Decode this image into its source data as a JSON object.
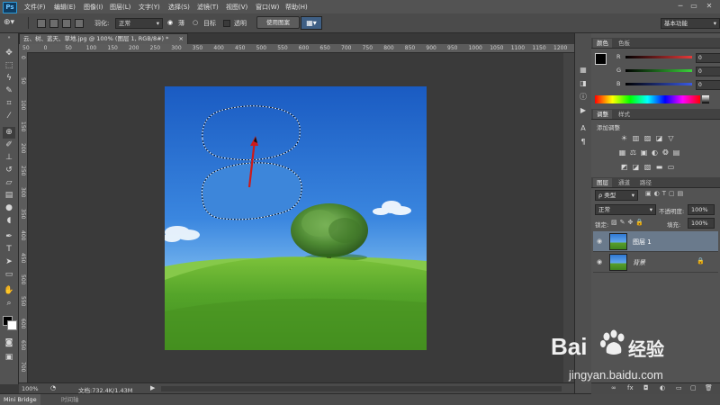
{
  "app": {
    "logo": "Ps"
  },
  "menu": [
    "文件(F)",
    "编辑(E)",
    "图像(I)",
    "图层(L)",
    "文字(Y)",
    "选择(S)",
    "滤镜(T)",
    "视图(V)",
    "窗口(W)",
    "帮助(H)"
  ],
  "window_controls": {
    "minimize": "─",
    "restore": "▭",
    "close": "✕"
  },
  "options": {
    "feather_label": "羽化:",
    "feather_value": "正常",
    "radio_normal": "薄",
    "radio_target": "目标",
    "checkbox_transparent": "透明",
    "use_pattern_button": "使用图案",
    "workspace": "基本功能"
  },
  "document": {
    "tab_title": "云、树、蓝天、草地.jpg @ 100% (图层 1, RGB/8#) *",
    "ruler_top": [
      "50",
      "0",
      "50",
      "100",
      "150",
      "200",
      "250",
      "300",
      "350",
      "400",
      "450",
      "500",
      "550",
      "600",
      "650",
      "700",
      "750",
      "800",
      "850",
      "900",
      "950",
      "1000",
      "1050",
      "1100",
      "1150",
      "1200"
    ],
    "ruler_left": [
      "0",
      "50",
      "100",
      "150",
      "200",
      "250",
      "300",
      "350",
      "400",
      "450",
      "500",
      "550",
      "600",
      "650",
      "700"
    ],
    "zoom": "100%",
    "doc_size": "文档:732.4K/1.43M"
  },
  "bottom_tabs": [
    "Mini Bridge",
    "时间轴"
  ],
  "color_panel": {
    "tabs": [
      "颜色",
      "色板"
    ],
    "channels": [
      {
        "label": "R",
        "value": "0",
        "color": "#e53a3a"
      },
      {
        "label": "G",
        "value": "0",
        "color": "#3ad13a"
      },
      {
        "label": "B",
        "value": "0",
        "color": "#3a5ae5"
      }
    ]
  },
  "adjust_panel": {
    "tabs": [
      "调整",
      "样式"
    ],
    "title": "添加调整",
    "row1": [
      "☀",
      "▥",
      "▨",
      "◪",
      "▽"
    ],
    "row2": [
      "▦",
      "⚖",
      "▣",
      "◐",
      "❂",
      "▤"
    ],
    "row3": [
      "◩",
      "◪",
      "▧",
      "▬",
      "▭"
    ]
  },
  "layers_panel": {
    "tabs": [
      "图层",
      "通道",
      "路径"
    ],
    "filter_label": "ρ 类型",
    "blend_mode": "正常",
    "opacity_label": "不透明度:",
    "opacity_value": "100%",
    "lock_label": "锁定:",
    "fill_label": "填充:",
    "fill_value": "100%",
    "layers": [
      {
        "name": "图层 1",
        "selected": true
      },
      {
        "name": "背景",
        "selected": false,
        "locked": true
      }
    ],
    "footer_icons": [
      "∞",
      "fx",
      "◘",
      "◐",
      "▭",
      "▢",
      "🗑"
    ]
  },
  "watermark": {
    "brand_prefix": "Bai",
    "brand_suffix": "经验",
    "url": "jingyan.baidu.com"
  },
  "colors": {
    "accent_red_arrow": "#cc1a1a",
    "sky_top": "#1d63c7",
    "sky_bottom": "#6fb4ef",
    "grass": "#4c9a27"
  }
}
